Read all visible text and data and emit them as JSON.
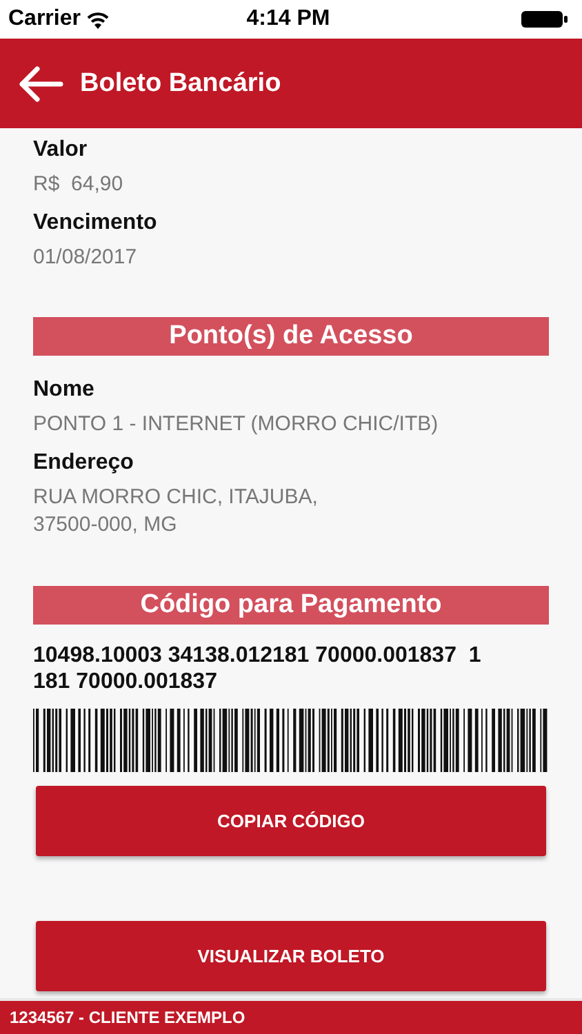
{
  "status_bar": {
    "carrier": "Carrier",
    "time": "4:14 PM"
  },
  "header": {
    "title": "Boleto Bancário"
  },
  "payment": [
    {
      "label": "Valor",
      "value": "R$  64,90"
    },
    {
      "label": "Vencimento",
      "value": "01/08/2017"
    }
  ],
  "access_section": {
    "title": "Ponto(s) de Acesso",
    "fields": [
      {
        "label": "Nome",
        "value": "PONTO 1 - INTERNET (MORRO CHIC/ITB)"
      },
      {
        "label": "Endereço",
        "value": "RUA MORRO CHIC, ITAJUBA, 37500-000, MG"
      }
    ]
  },
  "code_section": {
    "title": "Código para Pagamento",
    "code": "10498.10003 34138.012181 70000.001837  1 181 70000.001837"
  },
  "buttons": [
    "COPIAR CÓDIGO",
    "VISUALIZAR BOLETO"
  ],
  "footer": {
    "text": "1234567 - CLIENTE EXEMPLO"
  }
}
